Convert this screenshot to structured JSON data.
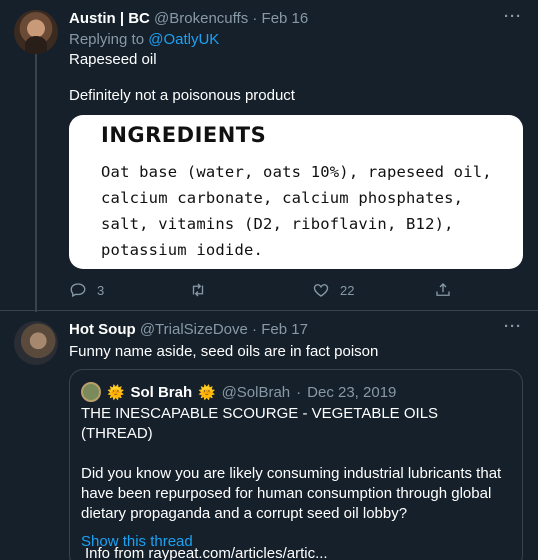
{
  "tweet1": {
    "display_name": "Austin | BC",
    "handle": "@Brokencuffs",
    "separator": "·",
    "date": "Feb 16",
    "more": "···",
    "replying_prefix": "Replying to",
    "replying_to": "@OatlyUK",
    "line1": "Rapeseed oil",
    "line2": "Definitely not a poisonous product",
    "media": {
      "title": "INGREDIENTS",
      "body": "Oat base (water, oats 10%), rapeseed oil, calcium carbonate, calcium phosphates, salt, vitamins (D2, riboflavin, B12), potassium iodide."
    },
    "reply_count": "3",
    "like_count": "22"
  },
  "tweet2": {
    "display_name": "Hot Soup",
    "handle": "@TrialSizeDove",
    "separator": "·",
    "date": "Feb 17",
    "more": "···",
    "text": "Funny name aside, seed oils are in fact poison",
    "quote": {
      "sun_left": "🌞",
      "display_name": "Sol Brah",
      "sun_right": "🌞",
      "handle": "@SolBrah",
      "separator": "·",
      "date": "Dec 23, 2019",
      "line1": "THE INESCAPABLE SCOURGE - VEGETABLE OILS (THREAD)",
      "line2": "Did you know you are likely consuming industrial lubricants that have been repurposed for human consumption through global dietary propaganda and a corrupt seed oil lobby?",
      "line3": "Info from raypeat.com/articles/artic...",
      "show_thread": "Show this thread"
    }
  }
}
